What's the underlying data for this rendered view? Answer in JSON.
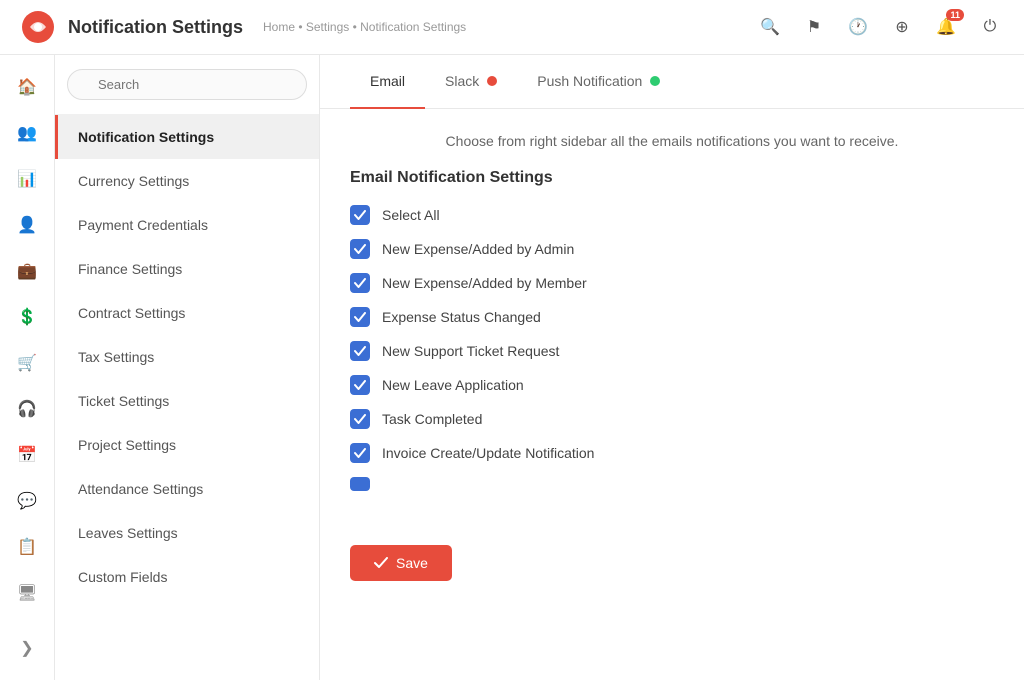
{
  "header": {
    "title": "Notification Settings",
    "breadcrumb": "Home • Settings • Notification Settings",
    "notification_count": "11"
  },
  "sidebar": {
    "search_placeholder": "Search",
    "items": [
      {
        "id": "notification-settings",
        "label": "Notification Settings",
        "active": true
      },
      {
        "id": "currency-settings",
        "label": "Currency Settings",
        "active": false
      },
      {
        "id": "payment-credentials",
        "label": "Payment Credentials",
        "active": false
      },
      {
        "id": "finance-settings",
        "label": "Finance Settings",
        "active": false
      },
      {
        "id": "contract-settings",
        "label": "Contract Settings",
        "active": false
      },
      {
        "id": "tax-settings",
        "label": "Tax Settings",
        "active": false
      },
      {
        "id": "ticket-settings",
        "label": "Ticket Settings",
        "active": false
      },
      {
        "id": "project-settings",
        "label": "Project Settings",
        "active": false
      },
      {
        "id": "attendance-settings",
        "label": "Attendance Settings",
        "active": false
      },
      {
        "id": "leaves-settings",
        "label": "Leaves Settings",
        "active": false
      },
      {
        "id": "custom-fields",
        "label": "Custom Fields",
        "active": false
      }
    ]
  },
  "tabs": [
    {
      "id": "email",
      "label": "Email",
      "active": true,
      "dot": null
    },
    {
      "id": "slack",
      "label": "Slack",
      "active": false,
      "dot": "red"
    },
    {
      "id": "push-notification",
      "label": "Push Notification",
      "active": false,
      "dot": "green"
    }
  ],
  "content": {
    "info_text": "Choose from right sidebar all the emails notifications you want to receive.",
    "section_title": "Email Notification Settings",
    "checkboxes": [
      {
        "id": "select-all",
        "label": "Select All",
        "checked": true
      },
      {
        "id": "new-expense-admin",
        "label": "New Expense/Added by Admin",
        "checked": true
      },
      {
        "id": "new-expense-member",
        "label": "New Expense/Added by Member",
        "checked": true
      },
      {
        "id": "expense-status-changed",
        "label": "Expense Status Changed",
        "checked": true
      },
      {
        "id": "new-support-ticket",
        "label": "New Support Ticket Request",
        "checked": true
      },
      {
        "id": "new-leave-application",
        "label": "New Leave Application",
        "checked": true
      },
      {
        "id": "task-completed",
        "label": "Task Completed",
        "checked": true
      },
      {
        "id": "invoice-create-update",
        "label": "Invoice Create/Update Notification",
        "checked": true
      },
      {
        "id": "extra-item",
        "label": "",
        "checked": true
      }
    ],
    "save_button_label": "Save"
  }
}
